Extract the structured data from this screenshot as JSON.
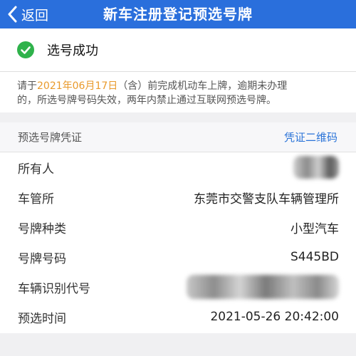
{
  "navbar": {
    "back_label": "返回",
    "title": "新车注册登记预选号牌"
  },
  "status": {
    "text": "选号成功",
    "icon": "check-circle-icon",
    "color": "#2fb24b"
  },
  "notice": {
    "prefix": "请于",
    "date": "2021年06月17日",
    "line1_rest": "（含）前完成机动车上牌，逾期未办理",
    "line2": "的，所选号牌号码失效，两年内禁止通过互联网预选号牌。",
    "date_color": "#e99a2b"
  },
  "section": {
    "label": "预选号牌凭证",
    "qr_link": "凭证二维码"
  },
  "details": [
    {
      "label": "所有人",
      "value": ""
    },
    {
      "label": "车管所",
      "value": "东莞市交警支队车辆管理所"
    },
    {
      "label": "号牌种类",
      "value": "小型汽车"
    },
    {
      "label": "号牌号码",
      "value": "S445BD"
    },
    {
      "label": "车辆识别代号",
      "value": ""
    },
    {
      "label": "预选时间",
      "value": "2021-05-26 20:42:00"
    }
  ],
  "colors": {
    "navbar": "#2a6fdc",
    "link": "#2a73d8"
  }
}
